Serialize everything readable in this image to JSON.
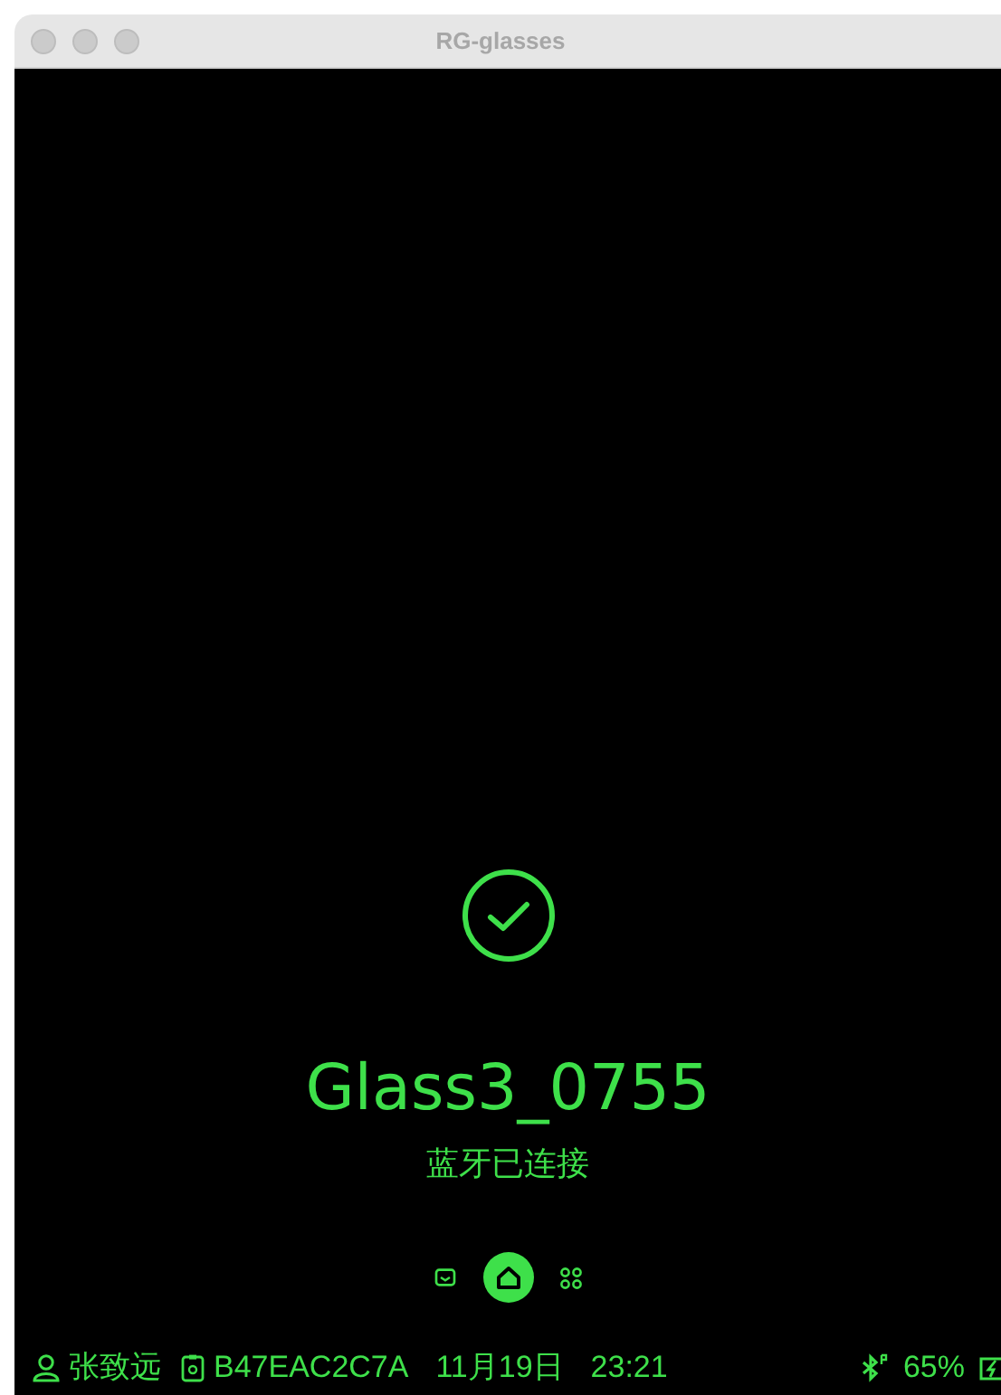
{
  "window": {
    "title": "RG-glasses"
  },
  "connection": {
    "device_name": "Glass3_0755",
    "status": "蓝牙已连接"
  },
  "nav": [
    {
      "kind": "mail",
      "selected": false
    },
    {
      "kind": "home",
      "selected": true
    },
    {
      "kind": "apps",
      "selected": false
    }
  ],
  "status_bar": {
    "user": "张致远",
    "device_id": "B47EAC2C7A",
    "date": "11月19日",
    "time": "23:21",
    "battery": "65%"
  }
}
